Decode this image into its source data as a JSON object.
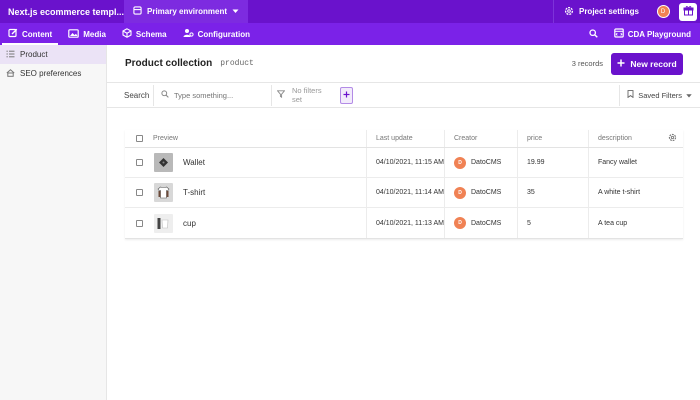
{
  "topbar": {
    "app_title": "Next.js ecommerce templ...",
    "environment": "Primary environment",
    "project_settings": "Project settings",
    "avatar_initial": "D"
  },
  "nav": {
    "items": [
      {
        "label": "Content",
        "icon": "pencil-icon",
        "active": true
      },
      {
        "label": "Media",
        "icon": "image-icon",
        "active": false
      },
      {
        "label": "Schema",
        "icon": "cube-icon",
        "active": false
      },
      {
        "label": "Configuration",
        "icon": "settings-people-icon",
        "active": false
      }
    ],
    "cda_playground": "CDA Playground"
  },
  "sidebar": {
    "items": [
      {
        "label": "Product",
        "icon": "list-icon",
        "active": true
      },
      {
        "label": "SEO preferences",
        "icon": "single-instance-icon",
        "active": false
      }
    ]
  },
  "header": {
    "title": "Product collection",
    "api_key": "product",
    "record_count": "3 records",
    "new_record": "New record"
  },
  "search": {
    "label": "Search",
    "placeholder": "Type something...",
    "filters": "No filters set",
    "saved_filters": "Saved Filters"
  },
  "table": {
    "columns": [
      "Preview",
      "Last update",
      "Creator",
      "price",
      "description"
    ],
    "rows": [
      {
        "name": "Wallet",
        "last_update": "04/10/2021, 11:15 AM",
        "creator": "DatoCMS",
        "creator_initial": "D",
        "price": "19.99",
        "description": "Fancy wallet"
      },
      {
        "name": "T-shirt",
        "last_update": "04/10/2021, 11:14 AM",
        "creator": "DatoCMS",
        "creator_initial": "D",
        "price": "35",
        "description": "A white t-shirt"
      },
      {
        "name": "cup",
        "last_update": "04/10/2021, 11:13 AM",
        "creator": "DatoCMS",
        "creator_initial": "D",
        "price": "5",
        "description": "A tea cup"
      }
    ]
  },
  "colors": {
    "topbar": "#6a12cc",
    "navbar": "#7b22e8",
    "accent": "#6a12cc",
    "avatar": "#f08254"
  }
}
